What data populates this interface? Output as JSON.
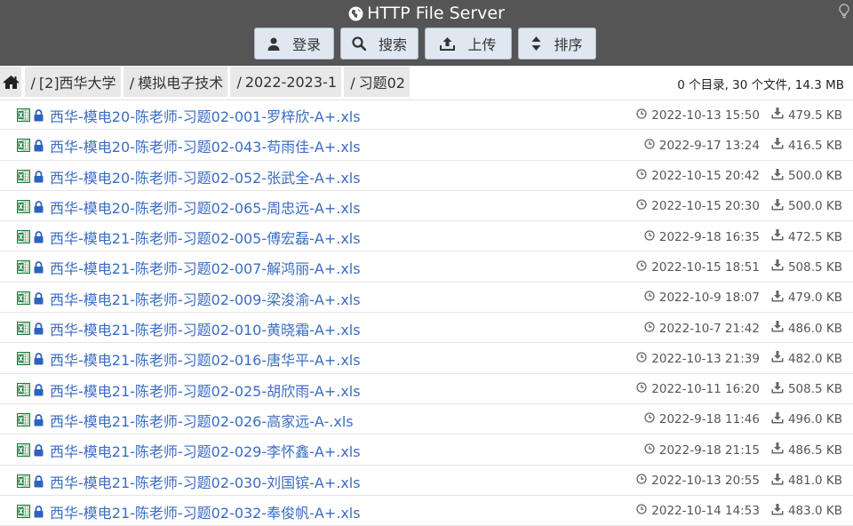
{
  "header": {
    "title": "HTTP File Server",
    "buttons": [
      {
        "label": "登录",
        "icon": "user-icon"
      },
      {
        "label": "搜索",
        "icon": "search-icon"
      },
      {
        "label": "上传",
        "icon": "upload-icon"
      },
      {
        "label": "排序",
        "icon": "sort-icon"
      }
    ]
  },
  "breadcrumb": {
    "items": [
      "[2]西华大学",
      "模拟电子技术",
      "2022-2023-1",
      "习题02"
    ],
    "summary": "0 个目录, 30 个文件, 14.3 MB"
  },
  "files": [
    {
      "name": "西华-模电20-陈老师-习题02-001-罗梓欣-A+.xls",
      "date": "2022-10-13 15:50",
      "size": "479.5 KB"
    },
    {
      "name": "西华-模电20-陈老师-习题02-043-苟雨佳-A+.xls",
      "date": "2022-9-17 13:24",
      "size": "416.5 KB"
    },
    {
      "name": "西华-模电20-陈老师-习题02-052-张武全-A+.xls",
      "date": "2022-10-15 20:42",
      "size": "500.0 KB"
    },
    {
      "name": "西华-模电20-陈老师-习题02-065-周忠远-A+.xls",
      "date": "2022-10-15 20:30",
      "size": "500.0 KB"
    },
    {
      "name": "西华-模电21-陈老师-习题02-005-傅宏磊-A+.xls",
      "date": "2022-9-18 16:35",
      "size": "472.5 KB"
    },
    {
      "name": "西华-模电21-陈老师-习题02-007-解鸿丽-A+.xls",
      "date": "2022-10-15 18:51",
      "size": "508.5 KB"
    },
    {
      "name": "西华-模电21-陈老师-习题02-009-梁浚渝-A+.xls",
      "date": "2022-10-9 18:07",
      "size": "479.0 KB"
    },
    {
      "name": "西华-模电21-陈老师-习题02-010-黄晓霜-A+.xls",
      "date": "2022-10-7 21:42",
      "size": "486.0 KB"
    },
    {
      "name": "西华-模电21-陈老师-习题02-016-唐华平-A+.xls",
      "date": "2022-10-13 21:39",
      "size": "482.0 KB"
    },
    {
      "name": "西华-模电21-陈老师-习题02-025-胡欣雨-A+.xls",
      "date": "2022-10-11 16:20",
      "size": "508.5 KB"
    },
    {
      "name": "西华-模电21-陈老师-习题02-026-高家远-A-.xls",
      "date": "2022-9-18 11:46",
      "size": "496.0 KB"
    },
    {
      "name": "西华-模电21-陈老师-习题02-029-李怀鑫-A+.xls",
      "date": "2022-9-18 21:15",
      "size": "486.5 KB"
    },
    {
      "name": "西华-模电21-陈老师-习题02-030-刘国镔-A+.xls",
      "date": "2022-10-13 20:55",
      "size": "481.0 KB"
    },
    {
      "name": "西华-模电21-陈老师-习题02-032-奉俊帆-A+.xls",
      "date": "2022-10-14 14:53",
      "size": "483.0 KB"
    }
  ],
  "colors": {
    "header_bg": "#555555",
    "button_bg": "#dfe8f0",
    "link": "#3a6dc2",
    "lock": "#2e62c0",
    "excel": "#1f7a3a"
  }
}
